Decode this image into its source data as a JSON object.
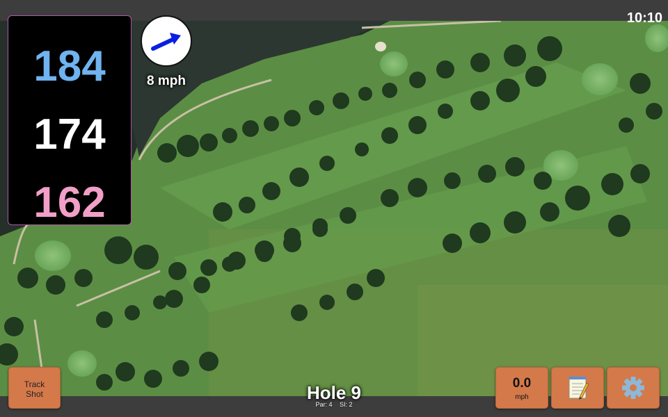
{
  "status": {
    "time": "10:10"
  },
  "yardages": {
    "back": "184",
    "middle": "174",
    "front": "162"
  },
  "wind": {
    "speed_label": "8 mph",
    "arrow_color": "#0a1fe0"
  },
  "hole": {
    "title": "Hole 9",
    "par_label": "Par: 4",
    "si_label": "SI: 2"
  },
  "buttons": {
    "track_shot_line1": "Track",
    "track_shot_line2": "Shot",
    "speed_value": "0.0",
    "speed_unit": "mph",
    "notes_icon": "notepad-icon",
    "settings_icon": "gear-icon"
  },
  "colors": {
    "back_yardage": "#6fb3f0",
    "middle_yardage": "#ffffff",
    "front_yardage": "#f29fc8",
    "button_orange": "#d4794a",
    "panel_border": "#b05aa8"
  }
}
